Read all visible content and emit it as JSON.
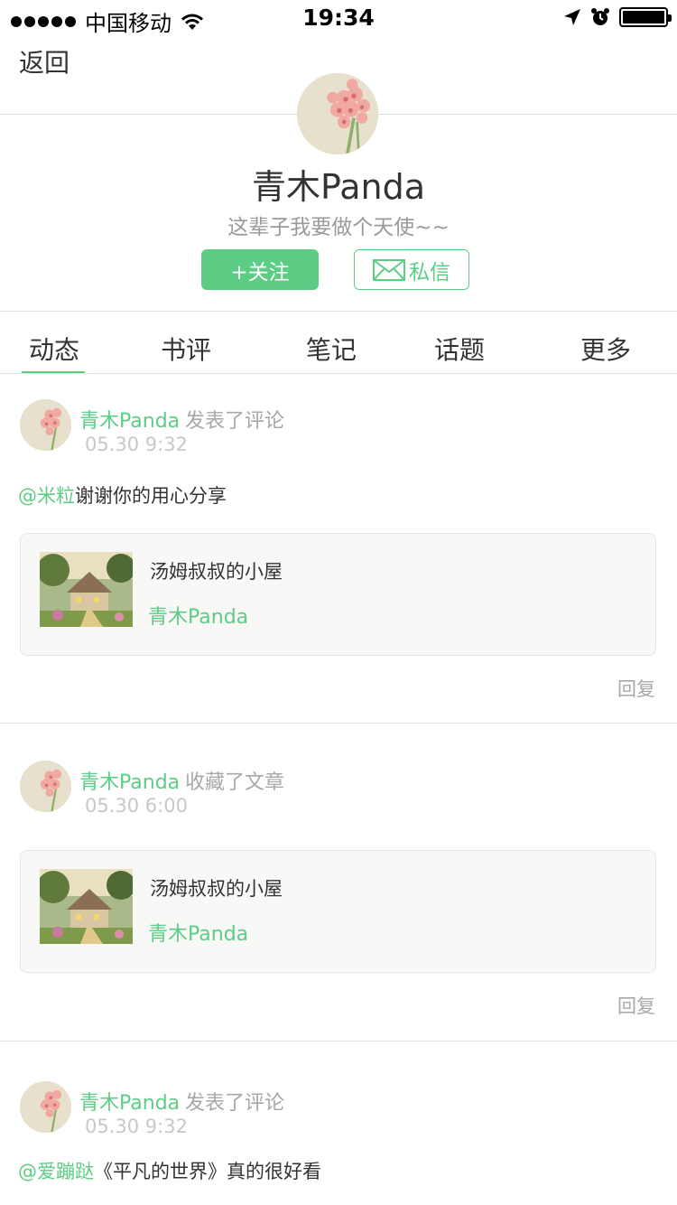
{
  "status_bar": {
    "carrier": "中国移动",
    "time": "19:34"
  },
  "nav": {
    "back_label": "返回"
  },
  "profile": {
    "name": "青木Panda",
    "bio": "这辈子我要做个天使~~",
    "follow_label": "+关注",
    "message_label": "私信"
  },
  "tabs": [
    {
      "label": "动态",
      "active": true
    },
    {
      "label": "书评",
      "active": false
    },
    {
      "label": "笔记",
      "active": false
    },
    {
      "label": "话题",
      "active": false
    },
    {
      "label": "更多",
      "active": false
    }
  ],
  "colors": {
    "accent": "#5dcd85"
  },
  "feed": [
    {
      "user": "青木Panda",
      "action": "发表了评论",
      "time": "05.30 9:32",
      "mention": "@米粒",
      "text": "谢谢你的用心分享",
      "card": {
        "title": "汤姆叔叔的小屋",
        "author": "青木Panda"
      },
      "reply_label": "回复"
    },
    {
      "user": "青木Panda",
      "action": "收藏了文章",
      "time": "05.30 6:00",
      "card": {
        "title": "汤姆叔叔的小屋",
        "author": "青木Panda"
      },
      "reply_label": "回复"
    },
    {
      "user": "青木Panda",
      "action": "发表了评论",
      "time": "05.30 9:32",
      "mention": "@爱蹦跶",
      "text": "《平凡的世界》真的很好看"
    }
  ]
}
